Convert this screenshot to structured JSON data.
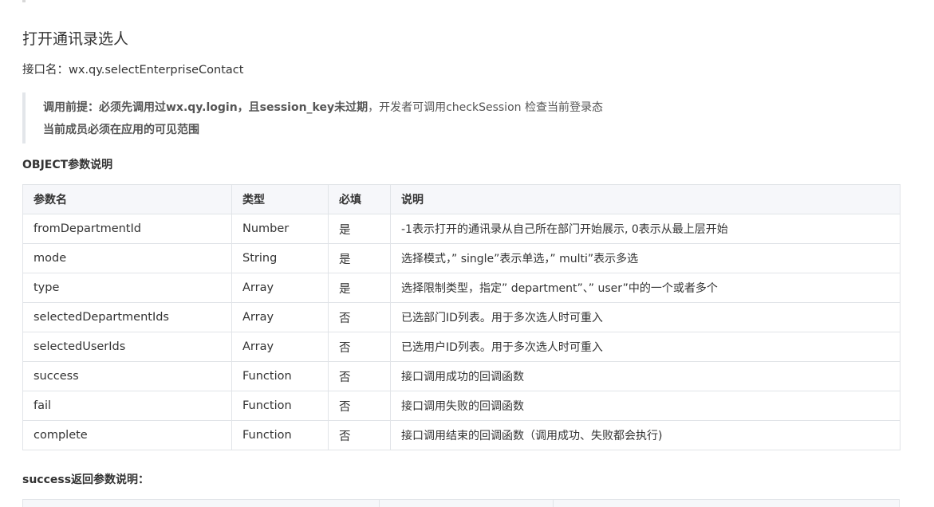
{
  "title": "打开通讯录选人",
  "api": {
    "label": "接口名：",
    "name": "wx.qy.selectEnterpriseContact"
  },
  "note": {
    "line1_bold": "调用前提：必须先调用过wx.qy.login，且session_key未过期",
    "line1_rest": "，开发者可调用checkSession 检查当前登录态",
    "line2_bold": "当前成员必须在应用的可见范围"
  },
  "object_section_title": "OBJECT参数说明",
  "params_table": {
    "headers": [
      "参数名",
      "类型",
      "必填",
      "说明"
    ],
    "rows": [
      [
        "fromDepartmentId",
        "Number",
        "是",
        "-1表示打开的通讯录从自己所在部门开始展示, 0表示从最上层开始"
      ],
      [
        "mode",
        "String",
        "是",
        "选择模式，” single”表示单选，” multi”表示多选"
      ],
      [
        "type",
        "Array",
        "是",
        "选择限制类型，指定” department”、” user”中的一个或者多个"
      ],
      [
        "selectedDepartmentIds",
        "Array",
        "否",
        "已选部门ID列表。用于多次选人时可重入"
      ],
      [
        "selectedUserIds",
        "Array",
        "否",
        "已选用户ID列表。用于多次选人时可重入"
      ],
      [
        "success",
        "Function",
        "否",
        "接口调用成功的回调函数"
      ],
      [
        "fail",
        "Function",
        "否",
        "接口调用失败的回调函数"
      ],
      [
        "complete",
        "Function",
        "否",
        "接口调用结束的回调函数（调用成功、失败都会执行)"
      ]
    ]
  },
  "success_section_title": "success返回参数说明："
}
